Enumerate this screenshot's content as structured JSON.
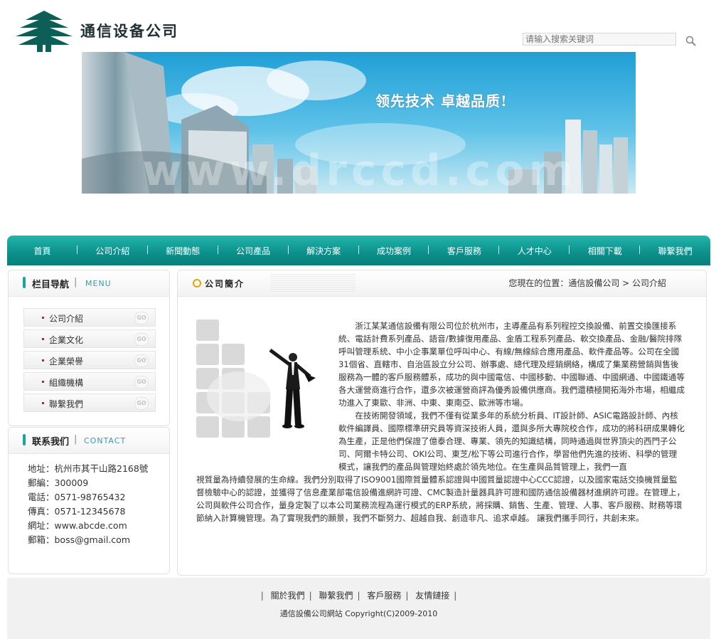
{
  "header": {
    "logo_text": "通信设备公司",
    "search_placeholder": "请输入搜索关键词"
  },
  "banner": {
    "slogan": "领先技术  卓越品质!",
    "watermark": "www.drccd.com"
  },
  "nav": {
    "items": [
      "首頁",
      "公司介紹",
      "新聞動態",
      "公司產品",
      "解決方案",
      "成功案例",
      "客戶服務",
      "人才中心",
      "相關下載",
      "聯繫我們"
    ]
  },
  "sidebar": {
    "menu_title": "栏目导航",
    "menu_title_en": "MENU",
    "menu_items": [
      "公司介紹",
      "企業文化",
      "企業榮譽",
      "組織機構",
      "聯繫我們"
    ],
    "go_label": "GO",
    "contact_title": "联系我们",
    "contact_title_en": "CONTACT",
    "contact_lines": [
      "地址：杭州市其干山路2168號",
      "郵編：300009",
      "電話：0571-98765432",
      "傳真：0571-12345678",
      "網址：www.abcde.com",
      "郵箱：boss@gmail.com"
    ]
  },
  "main": {
    "title": "公司簡介",
    "breadcrumb": "您現在的位置：通信設備公司 > 公司介紹",
    "para1": "浙江某某通信設備有限公司位於杭州市，主導產品有系列程控交換設備、前置交換匯接系統、電話計費系列產品、語音/數據復用產品、金盾工程系列產品、軟交換產品、金融/醫院排隊呼叫管理系統、中小企事業單位呼叫中心、有線/無線綜合應用產品、軟件產品等。公司在全國31個省、直轄市、自治區設立分公司、辦事處、總代理及經銷網絡，構成了集業務營銷與售後服務為一體的客戶服務體系，成功的與中國電信、中國移動、中國聯通、中國網通、中國鐵通等各大運營商進行合作，還多次被運營商評為優秀設備供應商。我們還積極開拓海外市場，相繼成功進入了東歐、非洲、中東、東南亞、歐洲等市場。",
    "para2a": "在技術開發領域，我們不僅有從業多年的系統分析員、IT設計師、ASIC電路設計師、內核軟件編譯員、國際標準研究員等資深技術人員，還與多所大專院校合作，成功的將科研成果轉化為生產，正是他們保證了億泰合理、專業、領先的知識結構，同時通過與世界頂尖的西門子公司、阿爾卡特公司、OKI公司、東芝/松下等公司進行合作，學習他們先進的技術、科學的管理模式，讓我們的產品與管理始終處於領先地位。在生產與品質管理上，我們一直",
    "para2b": "視質量為持續發展的生命線。我們分別取得了ISO9001國際質量體系認證與中國質量認證中心CCC認證，以及國家電話交換機質量監督檢驗中心的認證，並獲得了信息產業部電信設備進網許可證、CMC製造計量器具許可證和國防通信設備器材進網許可證。在管理上，公司與軟件公司合作，量身定製了以本公司業務流程為運行模式的ERP系統，將採購、銷售、生產、管理、人事、客戶服務、財務等環節納入計算機管理。為了實現我們的願景，我們不斷努力、超越自我、創造非凡、追求卓越。 讓我們攜手同行，共創未來。"
  },
  "footer": {
    "links": [
      "關於我們",
      "聯繫我們",
      "客戶服務",
      "友情鏈接"
    ],
    "copyright": "通信設備公司網站 Copyright(C)2009-2010"
  },
  "colors": {
    "nav": "#0c8f8a",
    "accent": "#1aa49e",
    "bullet": "#c8241e"
  }
}
